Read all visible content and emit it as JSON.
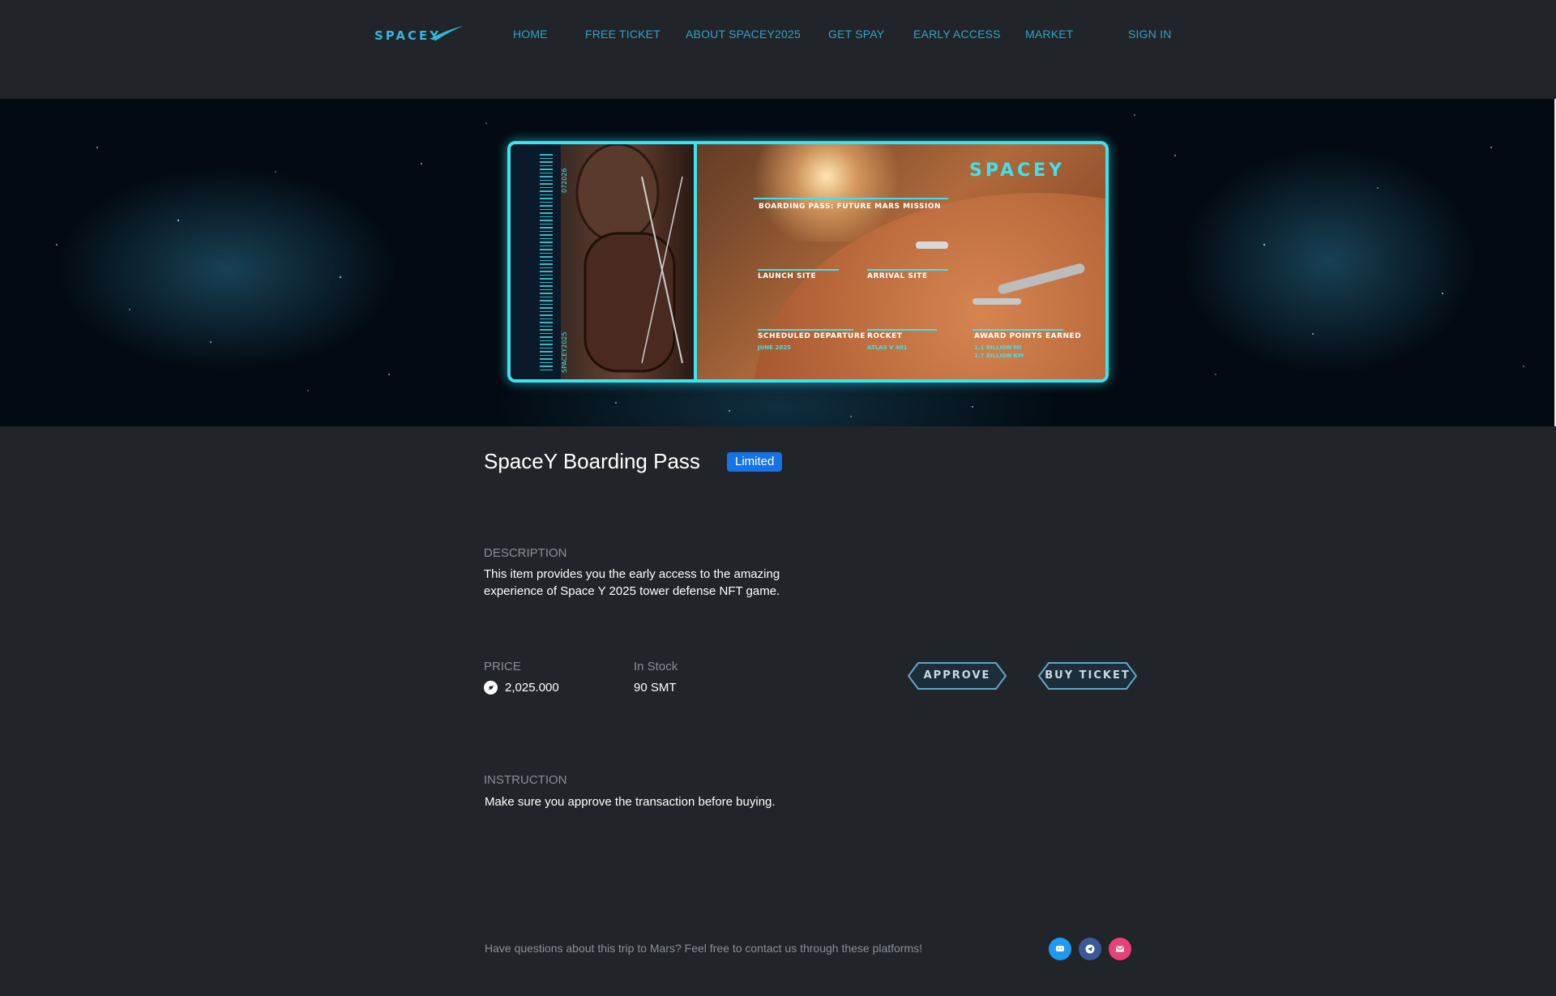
{
  "nav": {
    "logo_text": "SPACEY",
    "items": [
      "HOME",
      "FREE TICKET",
      "ABOUT SPACEY2025",
      "GET SPAY",
      "EARLY ACCESS",
      "MARKET"
    ],
    "sign_in": "SIGN IN"
  },
  "ticket": {
    "logo": "SPACEY",
    "heading": "BOARDING PASS: FUTURE MARS MISSION",
    "launch_site_label": "LAUNCH SITE",
    "arrival_site_label": "ARRIVAL SITE",
    "scheduled_departure_label": "SCHEDULED DEPARTURE",
    "scheduled_departure_value": "JUNE 2025",
    "rocket_label": "ROCKET",
    "rocket_value": "ATLAS V 401",
    "award_label": "AWARD POINTS EARNED",
    "award_value_1": "1.1 BILLION MI",
    "award_value_2": "1.7 BILLION KM",
    "stub_code": "072026",
    "stub_name": "SPACEY2025"
  },
  "product": {
    "title": "SpaceY Boarding Pass",
    "badge": "Limited",
    "description_label": "DESCRIPTION",
    "description_line1": "This item provides you the early access to the amazing",
    "description_line2": "experience of Space Y 2025 tower defense NFT game.",
    "price_label": "PRICE",
    "price_value": "2,025.000",
    "stock_label": "In Stock",
    "stock_value": "90 SMT",
    "approve_button": "APPROVE",
    "buy_button": "BUY TICKET",
    "instruction_label": "INSTRUCTION",
    "instruction_text": "Make sure you approve the transaction before buying."
  },
  "footer": {
    "contact_text": "Have questions about this trip to Mars? Feel free to contact us through these platforms!",
    "icons": [
      "discord-icon",
      "telegram-icon",
      "email-icon"
    ]
  },
  "colors": {
    "background": "#212428",
    "nav_link": "#2fa4c8",
    "accent_cyan": "#3be3f0",
    "badge_blue": "#1473e6",
    "muted": "#8a9096",
    "discord": "#1d9bf0",
    "telegram": "#3b5998",
    "email": "#e8417a"
  }
}
